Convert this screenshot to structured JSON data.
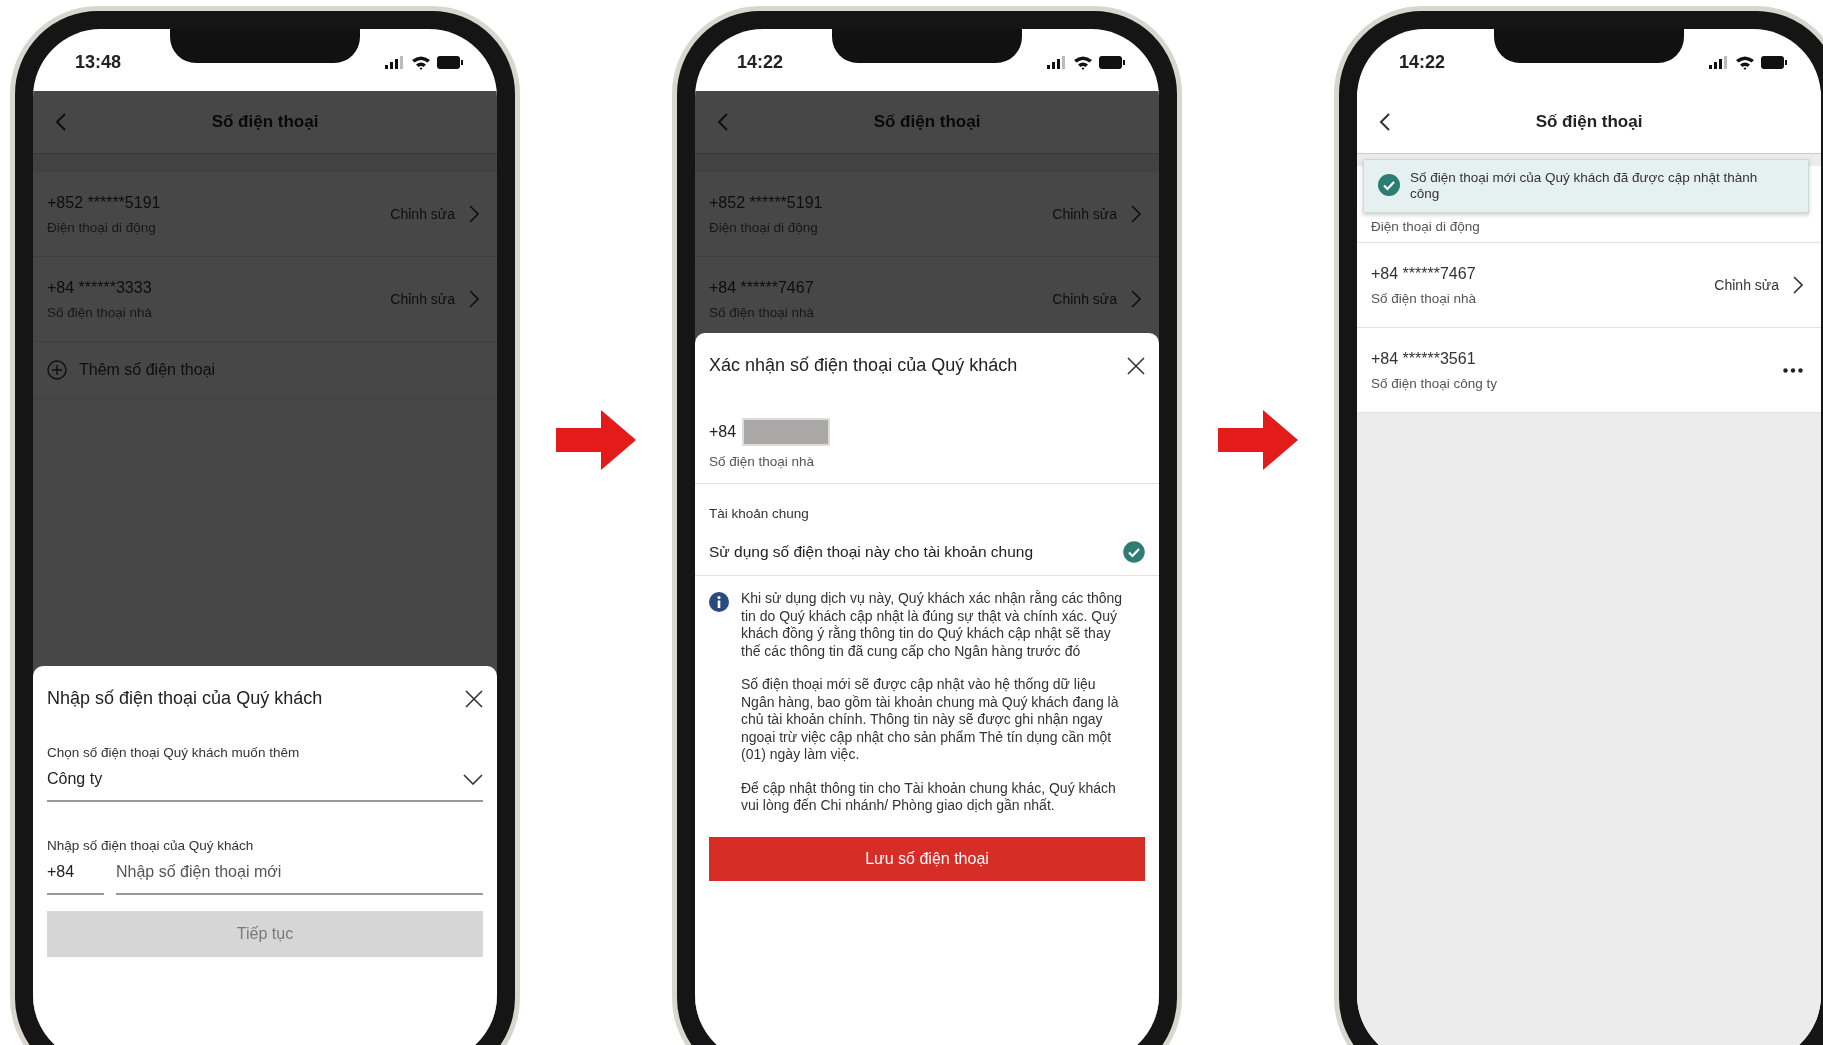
{
  "screens": [
    {
      "status_time": "13:48",
      "title": "Số điện thoại",
      "dimmed": true,
      "numbers": [
        {
          "kind": "edit",
          "number": "+852 ******5191",
          "type": "Điện thoại di động",
          "action": "Chỉnh sửa"
        },
        {
          "kind": "edit",
          "number": "+84 ******3333",
          "type": "Số điện thoại nhà",
          "action": "Chỉnh sửa"
        }
      ],
      "add_label": "Thêm số điện thoại",
      "sheet": {
        "kind": "input",
        "title": "Nhập số điện thoại của Quý khách",
        "select_label": "Chọn số điện thoại Quý khách muốn thêm",
        "select_value": "Công ty",
        "phone_label": "Nhập số điện thoại của Quý khách",
        "prefix": "+84",
        "placeholder": "Nhập số điện thoại mới",
        "button": "Tiếp tục",
        "button_disabled": true
      }
    },
    {
      "status_time": "14:22",
      "title": "Số điện thoại",
      "dimmed": true,
      "numbers": [
        {
          "kind": "edit",
          "number": "+852 ******5191",
          "type": "Điện thoại di động",
          "action": "Chỉnh sửa"
        },
        {
          "kind": "edit",
          "number": "+84 ******7467",
          "type": "Số điện thoại nhà",
          "action": "Chỉnh sửa"
        }
      ],
      "sheet": {
        "kind": "confirm",
        "title": "Xác nhận số điện thoại của Quý khách",
        "prefix": "+84",
        "number_type": "Số điện thoại nhà",
        "section": "Tài khoản chung",
        "option": {
          "label": "Sử dụng số điện thoại này cho tài khoản chung",
          "checked": true
        },
        "paragraphs": [
          "Khi sử dụng dịch vụ này, Quý khách xác nhận rằng các thông tin do Quý khách cập nhật là đúng sự thật và chính xác. Quý khách đồng ý rằng thông tin do Quý khách cập nhật sẽ thay thế các thông tin đã cung cấp cho Ngân hàng trước đó",
          "Số điện thoại mới sẽ được cập nhật vào hệ thống dữ liệu Ngân hàng, bao gồm tài khoản chung mà Quý khách đang là chủ tài khoản chính. Thông tin này sẽ được ghi nhận ngay ngoại trừ việc cập nhật cho sản phẩm Thẻ tín dụng cần một (01) ngày làm việc.",
          "Để cập nhật thông tin cho Tài khoản chung khác, Quý khách vui lòng đến Chi nhánh/ Phòng giao dịch gần nhất."
        ],
        "button": "Lưu số điện thoại",
        "button_disabled": false
      }
    },
    {
      "status_time": "14:22",
      "title": "Số điện thoại",
      "dimmed": false,
      "toast": "Số điện thoại mới của Quý khách đã được cập nhật thành công",
      "numbers": [
        {
          "kind": "partial",
          "type": "Điện thoại di động"
        },
        {
          "kind": "edit",
          "number": "+84 ******7467",
          "type": "Số điện thoại nhà",
          "action": "Chỉnh sửa"
        },
        {
          "kind": "more",
          "number": "+84 ******3561",
          "type": "Số điện thoại công ty"
        }
      ]
    }
  ]
}
